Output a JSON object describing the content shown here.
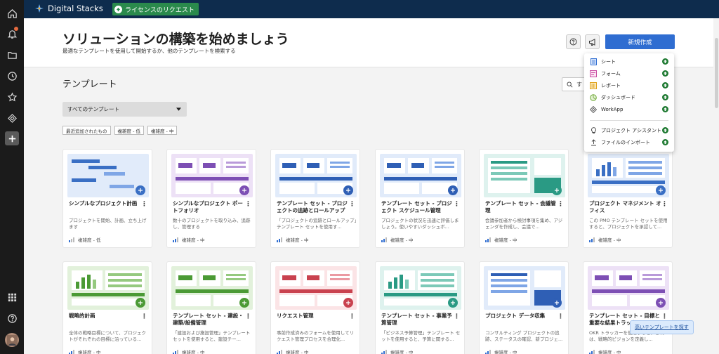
{
  "brand": {
    "name": "Digital Stacks"
  },
  "topbar": {
    "license_label": "ライセンスのリクエスト"
  },
  "header": {
    "title": "ソリューションの構築を始めましょう",
    "subtitle": "最適なテンプレートを使用して開始するか、他のテンプレートを検索する",
    "create_label": "新規作成"
  },
  "section": {
    "title": "テンプレート",
    "search_placeholder": "す"
  },
  "filter": {
    "selected": "すべてのテンプレート"
  },
  "chips": [
    "最近追加されたもの",
    "複雑度 - 低",
    "複雑度 - 中"
  ],
  "cards": [
    {
      "title": "シンプルなプロジェクト計画",
      "desc": "プロジェクトを開始、計画、立ち上げます",
      "difficulty": "複雑度 - 低",
      "level": 1
    },
    {
      "title": "シンプルなプロジェクト ポートフォリオ",
      "desc": "数十のプロジェクトを取り込み、追跡し、管理する",
      "difficulty": "複雑度 - 中",
      "level": 2
    },
    {
      "title": "テンプレート セット - プロジェクトの追跡とロールアップ",
      "desc": "「プロジェクトの追跡とロールアップ」テンプレート セットを使用す...",
      "difficulty": "複雑度 - 中",
      "level": 2
    },
    {
      "title": "テンプレート セット - プロジェクト スケジュール管理",
      "desc": "プロジェクトの状況を迅速に評価しましょう。使いやすいダッシュボ...",
      "difficulty": "複雑度 - 中",
      "level": 2
    },
    {
      "title": "テンプレート セット - 会議管理",
      "desc": "会議参加者から検討事項を集め、アジェンダを作成し、会議で...",
      "difficulty": "複雑度 - 中",
      "level": 2
    },
    {
      "title": "プロジェクト マネジメント オフィス",
      "desc": "この PMO テンプレート セットを使用すると、プロジェクトを承認して...",
      "difficulty": "複雑度 - 中",
      "level": 2
    },
    {
      "title": "戦略的計画",
      "desc": "全体の戦略目標について、プロジェクトがそれぞれの目標に沿っている...",
      "difficulty": "複雑度 - 中",
      "level": 2
    },
    {
      "title": "テンプレート セット - 建設・建築/設備管理",
      "desc": "「建設および施設管理」テンプレート セットを使用すると、建設チー...",
      "difficulty": "複雑度 - 中",
      "level": 2
    },
    {
      "title": "リクエスト管理",
      "desc": "事前作成済みのフォームを使用してリクエスト管理プロセスを合理化...",
      "difficulty": "複雑度 - 中",
      "level": 2
    },
    {
      "title": "テンプレート セット - 事業予算管理",
      "desc": "「ビジネス予算管理」テンプレート セットを使用すると、予算に関する...",
      "difficulty": "複雑度 - 中",
      "level": 2
    },
    {
      "title": "プロジェクト データ収集",
      "desc": "コンサルティング プロジェクトの追跡、ステータスの確認、新プロジェ...",
      "difficulty": "複雑度 - 中",
      "level": 2
    },
    {
      "title": "テンプレート セット - 目標と重要な結果トラッカー",
      "desc": "OKR トラッカーを使用すると、これは、戦略的ビジョンを定義し...",
      "difficulty": "複雑度 - 中",
      "level": 2
    }
  ],
  "menu": {
    "items": [
      {
        "label": "シート",
        "icon": "sheet-icon",
        "color": "#2f6dd1"
      },
      {
        "label": "フォーム",
        "icon": "form-icon",
        "color": "#c94da3"
      },
      {
        "label": "レポート",
        "icon": "report-icon",
        "color": "#e0a21b"
      },
      {
        "label": "ダッシュボード",
        "icon": "dashboard-icon",
        "color": "#6ea836"
      },
      {
        "label": "WorkApp",
        "icon": "workapp-icon",
        "color": "#555555"
      }
    ],
    "extras": [
      {
        "label": "プロジェクト アシスタント",
        "icon": "lightbulb-icon"
      },
      {
        "label": "ファイルのインポート",
        "icon": "import-icon"
      }
    ]
  },
  "tooltip": {
    "label": "高いテンプレートを探す"
  },
  "colors": {
    "topbar": "#0e2c4d",
    "rail": "#1b1b1b",
    "accent": "#2f6dd1",
    "upgrade": "#2a8a4c"
  }
}
